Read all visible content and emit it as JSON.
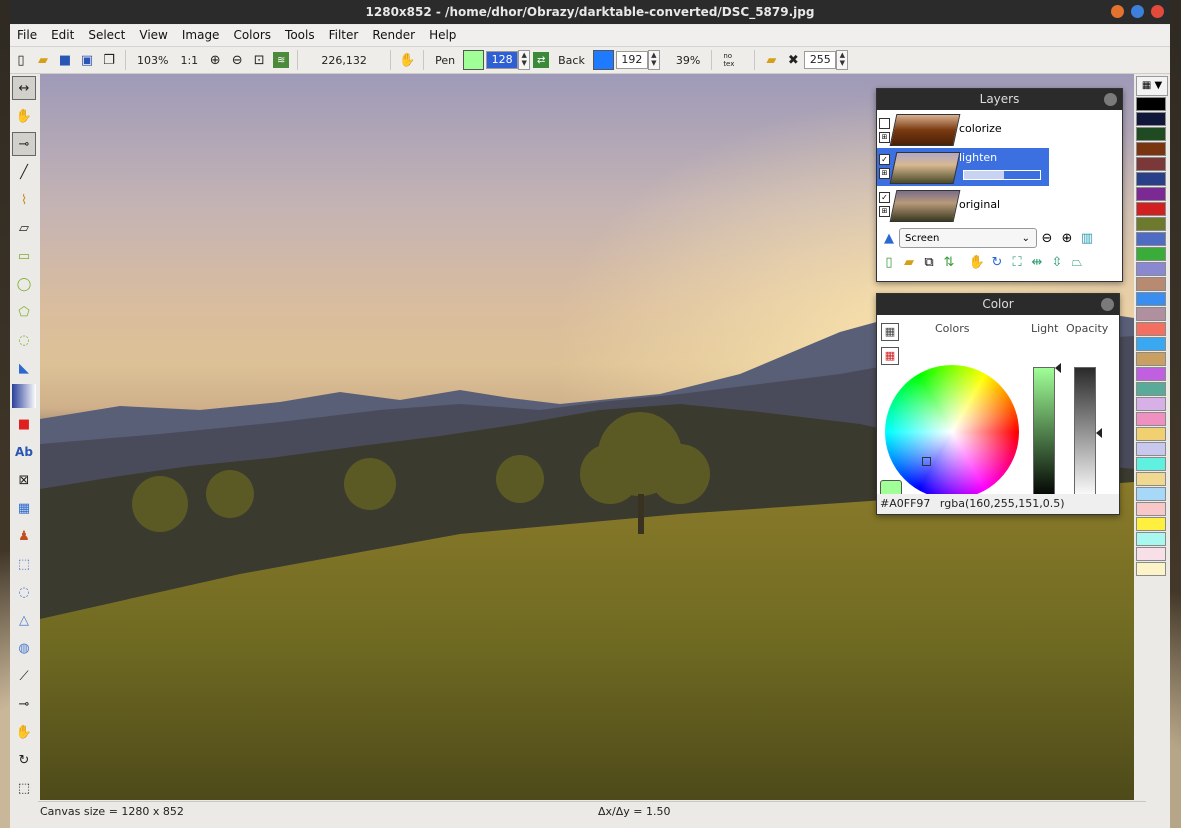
{
  "window": {
    "title": "1280x852 - /home/dhor/Obrazy/darktable-converted/DSC_5879.jpg",
    "controls": {
      "minimize": "#e3722f",
      "maximize": "#3e7fd9",
      "close": "#e24b3b"
    }
  },
  "menu": [
    "File",
    "Edit",
    "Select",
    "View",
    "Image",
    "Colors",
    "Tools",
    "Filter",
    "Render",
    "Help"
  ],
  "toolbar": {
    "zoom_percent": "103%",
    "zoom_ratio": "1:1",
    "cursor_coords": "226,132",
    "pen_label": "Pen",
    "pen_color": "#a0ff97",
    "pen_value": "128",
    "back_label": "Back",
    "back_color": "#1e7bff",
    "back_value": "192",
    "opacity_percent": "39%",
    "no_tex_label": "no\ntex",
    "alpha_value": "255"
  },
  "left_tools": [
    "move",
    "hand",
    "picker",
    "pen",
    "brush",
    "eraser",
    "rectangle",
    "ellipse",
    "polygon",
    "speech",
    "fill",
    "gradient",
    "rect-filled",
    "text",
    "deform",
    "checker",
    "stamp",
    "rect-select",
    "ellipse-select",
    "poly-select",
    "lasso-select",
    "magic-wand",
    "color-select",
    "hand-select",
    "rotate-select",
    "copy-select"
  ],
  "layers_panel": {
    "title": "Layers",
    "layers": [
      {
        "name": "colorize",
        "visible": false,
        "selected": false
      },
      {
        "name": "lighten",
        "visible": true,
        "selected": true,
        "opacity": 0.52
      },
      {
        "name": "original",
        "visible": true,
        "selected": false
      }
    ],
    "blend_mode": "Screen"
  },
  "color_panel": {
    "title": "Color",
    "colors_label": "Colors",
    "light_label": "Light",
    "opacity_label": "Opacity",
    "hex": "#A0FF97",
    "rgba": "rgba(160,255,151,0.5)",
    "current": "#a0ff97"
  },
  "palette": [
    "#000000",
    "#11173a",
    "#1f4a22",
    "#7a3410",
    "#7a3838",
    "#2a3f8a",
    "#7a2a92",
    "#d0201f",
    "#6d7a2e",
    "#4f6cc4",
    "#3aac3a",
    "#8a88d0",
    "#b88a72",
    "#3a8ef0",
    "#b0909e",
    "#f37060",
    "#3aa8f0",
    "#c9a062",
    "#c060e0",
    "#5aaa9a",
    "#d8b0e8",
    "#f090c0",
    "#f0d070",
    "#c8c8ee",
    "#60f0e0",
    "#f0d890",
    "#a8d8f8",
    "#f8c8c8",
    "#fff040",
    "#a8f8f0",
    "#f8e0e8",
    "#fcf4c8"
  ],
  "status": {
    "canvas_size": "Canvas size = 1280 x 852",
    "delta": "Δx/Δy = 1.50"
  }
}
